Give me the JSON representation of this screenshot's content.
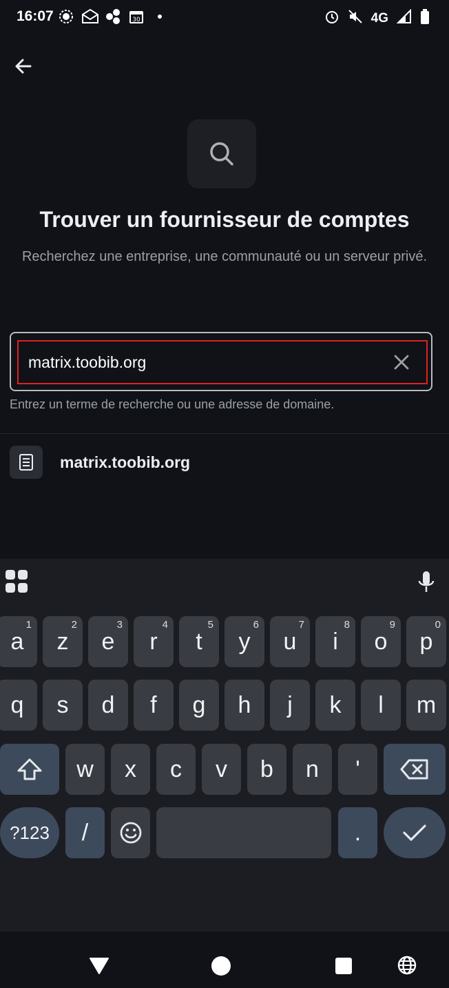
{
  "status": {
    "time": "16:07",
    "network": "4G"
  },
  "header": {
    "title": "Trouver un fournisseur de comptes",
    "subtitle": "Recherchez une entreprise, une communauté ou un serveur privé."
  },
  "search": {
    "value": "matrix.toobib.org",
    "helper": "Entrez un terme de recherche ou une adresse de domaine."
  },
  "results": [
    {
      "label": "matrix.toobib.org"
    }
  ],
  "keyboard": {
    "row1": [
      {
        "k": "a",
        "h": "1"
      },
      {
        "k": "z",
        "h": "2"
      },
      {
        "k": "e",
        "h": "3"
      },
      {
        "k": "r",
        "h": "4"
      },
      {
        "k": "t",
        "h": "5"
      },
      {
        "k": "y",
        "h": "6"
      },
      {
        "k": "u",
        "h": "7"
      },
      {
        "k": "i",
        "h": "8"
      },
      {
        "k": "o",
        "h": "9"
      },
      {
        "k": "p",
        "h": "0"
      }
    ],
    "row2": [
      "q",
      "s",
      "d",
      "f",
      "g",
      "h",
      "j",
      "k",
      "l",
      "m"
    ],
    "row3": [
      "w",
      "x",
      "c",
      "v",
      "b",
      "n",
      "'"
    ],
    "symbols_label": "?123",
    "slash": "/",
    "period": "."
  },
  "colors": {
    "background": "#101217",
    "focus_outline": "#e02020",
    "key": "#3a3c43",
    "mod_key": "#3d4a5c"
  }
}
